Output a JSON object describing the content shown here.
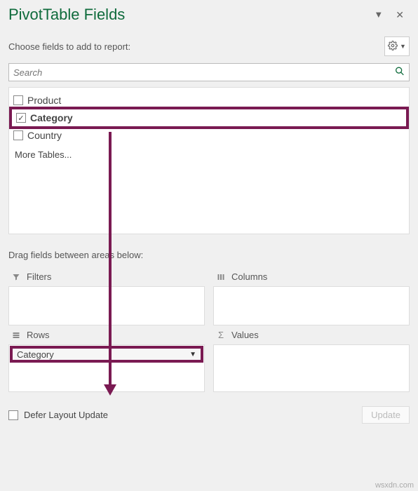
{
  "header": {
    "title": "PivotTable Fields"
  },
  "subheader": "Choose fields to add to report:",
  "search": {
    "placeholder": "Search"
  },
  "fields": [
    {
      "label": "Product",
      "checked": false,
      "highlighted": false
    },
    {
      "label": "Category",
      "checked": true,
      "highlighted": true
    },
    {
      "label": "Country",
      "checked": false,
      "highlighted": false
    }
  ],
  "more_tables": "More Tables...",
  "drag_label": "Drag fields between areas below:",
  "areas": {
    "filters": {
      "label": "Filters"
    },
    "columns": {
      "label": "Columns"
    },
    "rows": {
      "label": "Rows",
      "items": [
        "Category"
      ]
    },
    "values": {
      "label": "Values"
    }
  },
  "footer": {
    "defer_label": "Defer Layout Update",
    "update_label": "Update"
  },
  "watermark": "wsxdn.com",
  "accent_color": "#7a1a52"
}
